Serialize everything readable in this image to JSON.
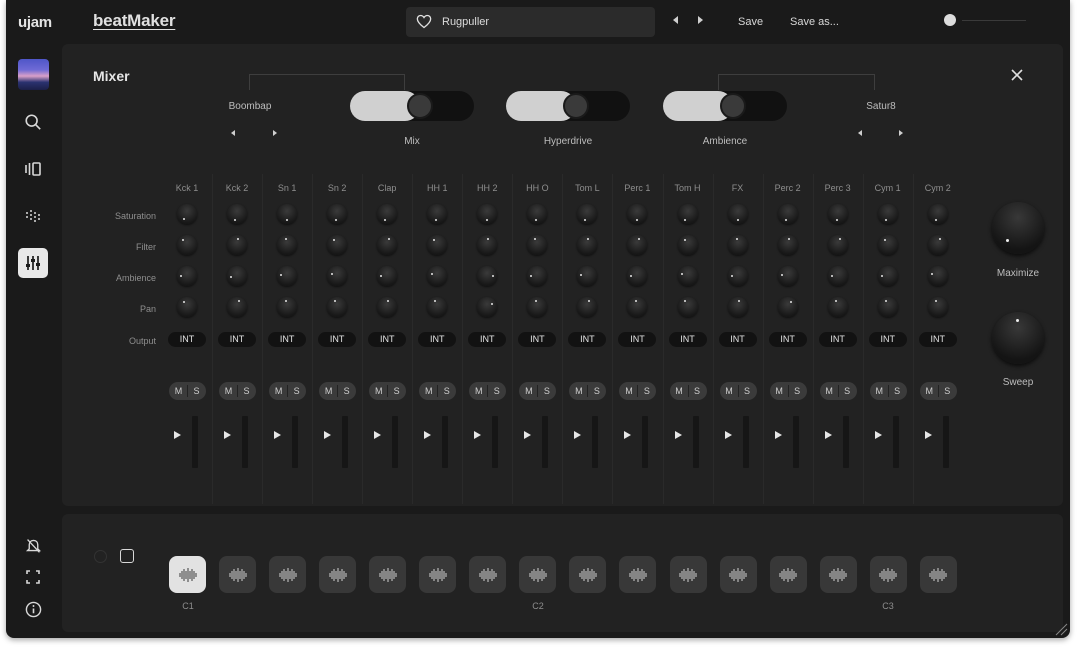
{
  "app": {
    "logo": "ujam",
    "product": "beatMaker"
  },
  "preset": {
    "name": "Rugpuller",
    "icon": "heart-icon"
  },
  "toolbar": {
    "save": "Save",
    "save_as": "Save as..."
  },
  "mixer": {
    "title": "Mixer",
    "style_left": "Boombap",
    "style_right": "Satur8",
    "toggles": [
      {
        "label": "Mix",
        "value": 0.5
      },
      {
        "label": "Hyperdrive",
        "value": 0.5
      },
      {
        "label": "Ambience",
        "value": 0.5
      }
    ],
    "row_labels": [
      "Saturation",
      "Filter",
      "Ambience",
      "Pan",
      "Output"
    ],
    "channels": [
      "Kck 1",
      "Kck 2",
      "Sn 1",
      "Sn 2",
      "Clap",
      "HH 1",
      "HH 2",
      "HH O",
      "Tom L",
      "Perc 1",
      "Tom H",
      "FX",
      "Perc 2",
      "Perc 3",
      "Cym 1",
      "Cym 2"
    ],
    "output_value": "INT",
    "mute": "M",
    "solo": "S",
    "master": [
      {
        "label": "Maximize",
        "value": 0.0
      },
      {
        "label": "Sweep",
        "value": 0.5
      }
    ]
  },
  "pads": {
    "count": 16,
    "active": 0,
    "note_labels": [
      "C1",
      "C2",
      "C3"
    ],
    "icon": "waveform-icon"
  },
  "sidebar": {
    "items": [
      "preset-thumbnail",
      "search-icon",
      "browser-icon",
      "pattern-icon",
      "mixer-icon"
    ],
    "bottom": [
      "bell-off-icon",
      "fullscreen-icon",
      "info-icon"
    ]
  },
  "colors": {
    "background": "#1a1a1a",
    "panel": "#222222",
    "active_pad": "#e2e2e2",
    "active_sidebar": "#e8e8e8"
  }
}
